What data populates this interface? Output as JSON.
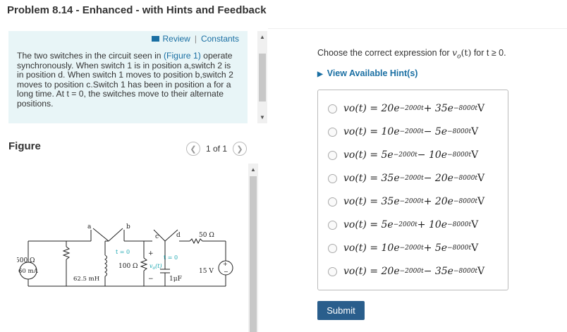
{
  "header": {
    "title": "Problem 8.14 - Enhanced - with Hints and Feedback"
  },
  "info": {
    "review_label": "Review",
    "separator": "|",
    "constants_label": "Constants",
    "problem_lines": [
      "The two switches in the circuit seen in ",
      "(Figure 1)",
      " operate synchronously. When switch 1 is in position a,switch 2 is in position d. When switch 1 moves to position b,switch 2 moves to position c.Switch 1 has been in position a for a long time. At t = 0, the switches move to their alternate positions."
    ]
  },
  "figure": {
    "label": "Figure",
    "pager_text": "1 of 1",
    "circuit": {
      "source_current": "60 mA",
      "r1": "500 Ω",
      "l1": "62.5 mH",
      "r2": "100 Ω",
      "vo": "v",
      "vo_sub": "o",
      "vo_tail": "(t)",
      "plus": "+",
      "minus": "−",
      "r3": "50 Ω",
      "cap": "1μF",
      "vs": "15 V",
      "t0a": "t = 0",
      "t0b": "t = 0",
      "pa": "a",
      "pb": "b",
      "pc": "c",
      "pd": "d"
    }
  },
  "question": {
    "text_pre": "Choose the correct expression for ",
    "text_var": "v",
    "text_sub": "o",
    "text_t": "(t)",
    "text_post": " for t ≥ 0.",
    "hint_label": "View Available Hint(s)"
  },
  "options": [
    {
      "lhs": "vo(t) = 20e",
      "e1": "−2000t",
      "mid": " + 35e",
      "e2": "−8000t",
      "unit": " V"
    },
    {
      "lhs": "vo(t) = 10e",
      "e1": "−2000t",
      "mid": " − 5e",
      "e2": "−8000t",
      "unit": " V"
    },
    {
      "lhs": "vo(t) = 5e",
      "e1": "−2000t",
      "mid": " − 10e",
      "e2": "−8000t",
      "unit": " V"
    },
    {
      "lhs": "vo(t) = 35e",
      "e1": "−2000t",
      "mid": " − 20e",
      "e2": "−8000t",
      "unit": " V"
    },
    {
      "lhs": "vo(t) = 35e",
      "e1": "−2000t",
      "mid": " + 20e",
      "e2": "−8000t",
      "unit": " V"
    },
    {
      "lhs": "vo(t) = 5e",
      "e1": "−2000t",
      "mid": " + 10e",
      "e2": "−8000t",
      "unit": " V"
    },
    {
      "lhs": "vo(t) = 10e",
      "e1": "−2000t",
      "mid": " + 5e",
      "e2": "−8000t",
      "unit": " V"
    },
    {
      "lhs": "vo(t) = 20e",
      "e1": "−2000t",
      "mid": " − 35e",
      "e2": "−8000t",
      "unit": " V"
    }
  ],
  "submit_label": "Submit",
  "colors": {
    "link": "#1a6fa3",
    "info_bg": "#e8f5f7",
    "submit_bg": "#2a5e8c"
  }
}
